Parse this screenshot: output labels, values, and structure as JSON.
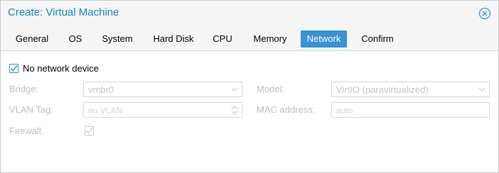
{
  "window": {
    "title": "Create: Virtual Machine",
    "close_icon": "close-circle-icon"
  },
  "tabs": [
    {
      "label": "General",
      "active": false
    },
    {
      "label": "OS",
      "active": false
    },
    {
      "label": "System",
      "active": false
    },
    {
      "label": "Hard Disk",
      "active": false
    },
    {
      "label": "CPU",
      "active": false
    },
    {
      "label": "Memory",
      "active": false
    },
    {
      "label": "Network",
      "active": true
    },
    {
      "label": "Confirm",
      "active": false
    }
  ],
  "form": {
    "no_network": {
      "label": "No network device",
      "checked": true
    },
    "bridge": {
      "label": "Bridge:",
      "value": "vmbr0",
      "disabled": true
    },
    "vlan": {
      "label": "VLAN Tag:",
      "placeholder": "no VLAN",
      "disabled": true
    },
    "firewall": {
      "label": "Firewall:",
      "checked": true,
      "disabled": true
    },
    "model": {
      "label": "Model:",
      "value": "VirtIO (paravirtualized)",
      "disabled": true
    },
    "mac": {
      "label": "MAC address:",
      "placeholder": "auto",
      "disabled": true
    }
  },
  "colors": {
    "accent": "#3892d4",
    "title": "#157fcc",
    "disabled_text": "#bdbdbd"
  }
}
